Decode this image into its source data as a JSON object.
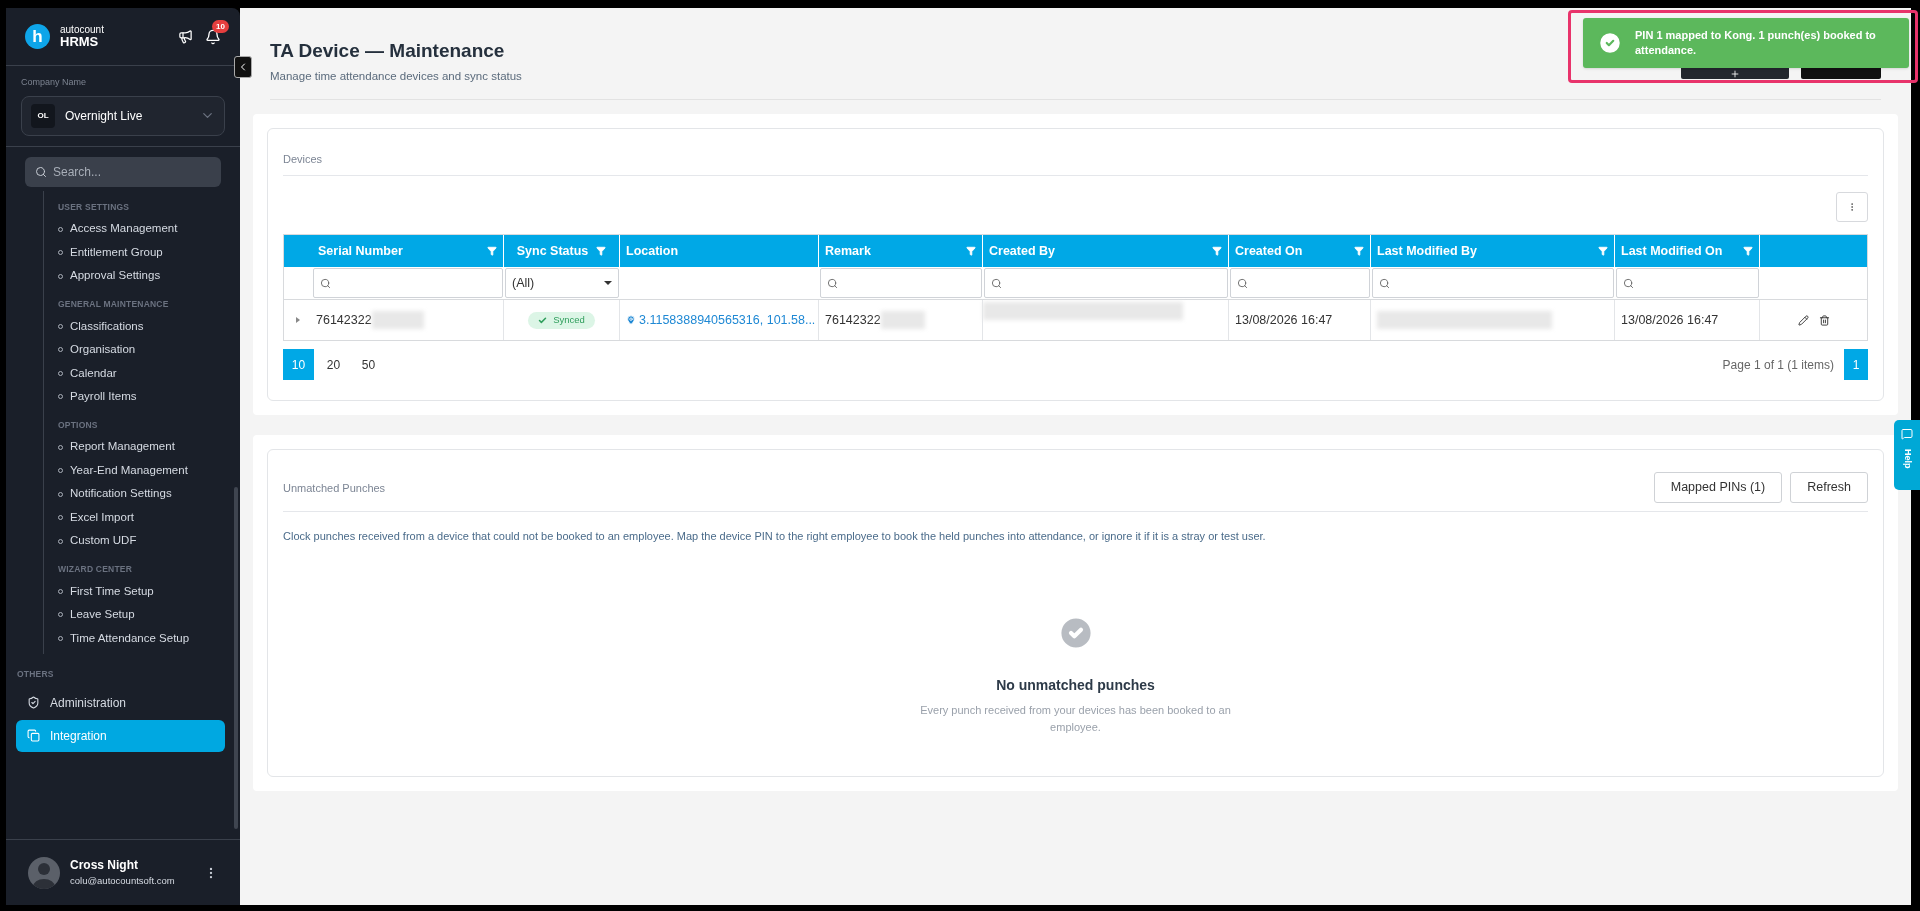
{
  "sidebar": {
    "brand": {
      "logo_letter": "h",
      "line1": "autocount",
      "line2": "HRMS"
    },
    "notifications_badge": "10",
    "company": {
      "label": "Company Name",
      "initials": "OL",
      "name": "Overnight Live"
    },
    "search": {
      "placeholder": "Search..."
    },
    "sections": [
      {
        "title": "USER SETTINGS",
        "items": [
          {
            "label": "Access Management",
            "selected": false
          },
          {
            "label": "Entitlement Group",
            "selected": false
          },
          {
            "label": "Approval Settings",
            "selected": false
          }
        ]
      },
      {
        "title": "GENERAL MAINTENANCE",
        "items": [
          {
            "label": "Classifications",
            "selected": false
          },
          {
            "label": "Organisation",
            "selected": false
          },
          {
            "label": "Calendar",
            "selected": false
          },
          {
            "label": "Payroll Items",
            "selected": false
          }
        ]
      },
      {
        "title": "OPTIONS",
        "items": [
          {
            "label": "Report Management",
            "selected": false
          },
          {
            "label": "Year-End Management",
            "selected": false
          },
          {
            "label": "Notification Settings",
            "selected": false
          },
          {
            "label": "Excel Import",
            "selected": false
          },
          {
            "label": "Custom UDF",
            "selected": false
          }
        ]
      },
      {
        "title": "WIZARD CENTER",
        "items": [
          {
            "label": "First Time Setup",
            "selected": false
          },
          {
            "label": "Leave Setup",
            "selected": false
          },
          {
            "label": "Time Attendance Setup",
            "selected": false
          }
        ]
      }
    ],
    "others": {
      "title": "OTHERS",
      "items": [
        {
          "label": "Administration",
          "selected": false
        },
        {
          "label": "Integration",
          "selected": true
        }
      ]
    },
    "user": {
      "name": "Cross Night",
      "email": "colu@autocountsoft.com"
    }
  },
  "page": {
    "title": "TA Device — Maintenance",
    "subtitle": "Manage time attendance devices and sync status"
  },
  "toast": {
    "message": "PIN 1 mapped to Kong. 1 punch(es) booked to attendance."
  },
  "devices": {
    "title": "Devices",
    "columns": [
      {
        "label": "Serial Number",
        "filter": true,
        "kind": "search"
      },
      {
        "label": "Sync Status",
        "filter": true,
        "kind": "select",
        "filter_value": "(All)"
      },
      {
        "label": "Location",
        "filter": false,
        "kind": "none"
      },
      {
        "label": "Remark",
        "filter": true,
        "kind": "search"
      },
      {
        "label": "Created By",
        "filter": true,
        "kind": "search"
      },
      {
        "label": "Created On",
        "filter": true,
        "kind": "date"
      },
      {
        "label": "Last Modified By",
        "filter": true,
        "kind": "search"
      },
      {
        "label": "Last Modified On",
        "filter": true,
        "kind": "date"
      }
    ],
    "rows": [
      {
        "expanded": false,
        "serial": "76142322",
        "sync_status": "Synced",
        "location": "3.1158388940565316, 101.58...",
        "remark": "76142322",
        "created_on": "13/08/2026 16:47",
        "last_modified_on": "13/08/2026 16:47"
      }
    ],
    "page_sizes": [
      {
        "label": "10",
        "selected": true
      },
      {
        "label": "20",
        "selected": false
      },
      {
        "label": "50",
        "selected": false
      }
    ],
    "page_info": "Page 1 of 1 (1 items)",
    "pages": [
      {
        "label": "1",
        "selected": true
      }
    ]
  },
  "unmatched": {
    "title": "Unmatched Punches",
    "buttons": [
      "Mapped PINs (1)",
      "Refresh"
    ],
    "description": "Clock punches received from a device that could not be booked to an employee. Map the device PIN to the right employee to book the held punches into attendance, or ignore it if it is a stray or test user.",
    "empty_title": "No unmatched punches",
    "empty_text": "Every punch received from your devices has been booked to an employee."
  },
  "help_tab": "Help"
}
